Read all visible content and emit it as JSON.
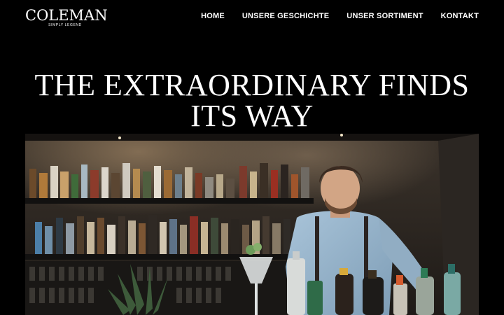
{
  "brand": {
    "name": "COLEMAN",
    "tagline": "SIMPLY LEGEND"
  },
  "nav": {
    "items": [
      {
        "label": "HOME"
      },
      {
        "label": "UNSERE GESCHICHTE"
      },
      {
        "label": "UNSER SORTIMENT"
      },
      {
        "label": "KONTAKT"
      }
    ]
  },
  "hero": {
    "title": "THE EXTRAORDINARY FINDS ITS WAY"
  },
  "colors": {
    "background": "#000000",
    "text": "#ffffff"
  }
}
